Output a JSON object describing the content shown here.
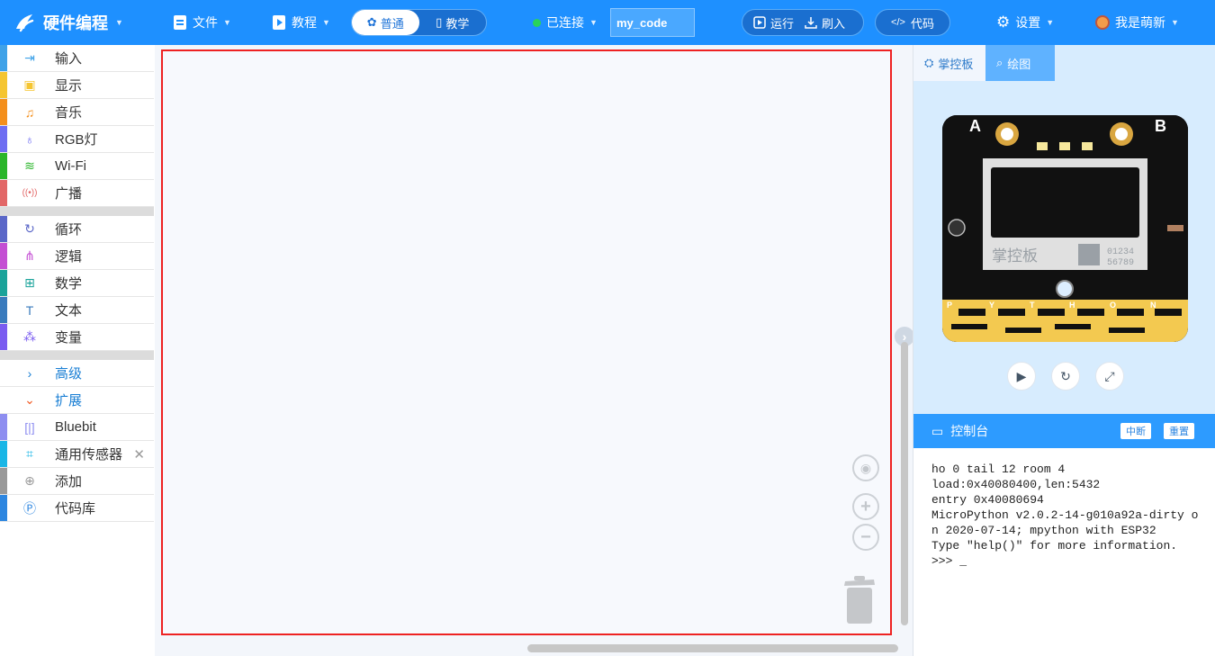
{
  "app": {
    "title": "硬件编程"
  },
  "toolbar": {
    "file_label": "文件",
    "tutorial_label": "教程",
    "mode_normal": "普通",
    "mode_teach": "教学",
    "connection_status": "已连接",
    "project_name": "my_code",
    "run_label": "运行",
    "flash_label": "刷入",
    "code_label": "代码",
    "settings_label": "设置",
    "user_name": "我是萌新"
  },
  "sidebar": {
    "categories": [
      {
        "label": "输入",
        "icon": "input-icon",
        "color": "#3fa2e8"
      },
      {
        "label": "显示",
        "icon": "display-icon",
        "color": "#f5c531"
      },
      {
        "label": "音乐",
        "icon": "music-icon",
        "color": "#f48f1c"
      },
      {
        "label": "RGB灯",
        "icon": "bulb-icon",
        "color": "#6f6ef2"
      },
      {
        "label": "Wi-Fi",
        "icon": "wifi-icon",
        "color": "#2ab52a"
      },
      {
        "label": "广播",
        "icon": "broadcast-icon",
        "color": "#e26767"
      },
      {
        "label": "循环",
        "icon": "loop-icon",
        "color": "#5b67c8"
      },
      {
        "label": "逻辑",
        "icon": "logic-icon",
        "color": "#c44fd3"
      },
      {
        "label": "数学",
        "icon": "math-icon",
        "color": "#1aa39a"
      },
      {
        "label": "文本",
        "icon": "text-icon",
        "color": "#3a7bbd"
      },
      {
        "label": "变量",
        "icon": "variable-icon",
        "color": "#7a5cf0"
      }
    ],
    "advanced_label": "高级",
    "extension_label": "扩展",
    "extensions": [
      {
        "label": "Bluebit",
        "icon": "bluebit-icon",
        "color": "#8e8ef0"
      },
      {
        "label": "通用传感器",
        "icon": "sensor-icon",
        "color": "#19b6e6"
      },
      {
        "label": "添加",
        "icon": "add-icon",
        "color": "#999999"
      },
      {
        "label": "代码库",
        "icon": "library-icon",
        "color": "#2d86e0"
      }
    ]
  },
  "right_panel": {
    "tab_board": "掌控板",
    "tab_draw": "绘图",
    "board": {
      "button_a": "A",
      "button_b": "B",
      "brand": "掌控板",
      "serial": "01234\n56789",
      "pins": [
        "P",
        "Y",
        "T",
        "H",
        "O",
        "N"
      ],
      "logo_text": "PYTHON"
    },
    "console_title": "控制台",
    "console_interrupt": "中断",
    "console_reset": "重置",
    "console_output": "ho 0 tail 12 room 4\nload:0x40080400,len:5432\nentry 0x40080694\nMicroPython v2.0.2-14-g010a92a-dirty on 2020-07-14; mpython with ESP32\nType \"help()\" for more information.\n>>> _"
  },
  "colors": {
    "header": "#1e90ff",
    "connected": "#29d25a",
    "workspace_frame": "#e22222"
  }
}
